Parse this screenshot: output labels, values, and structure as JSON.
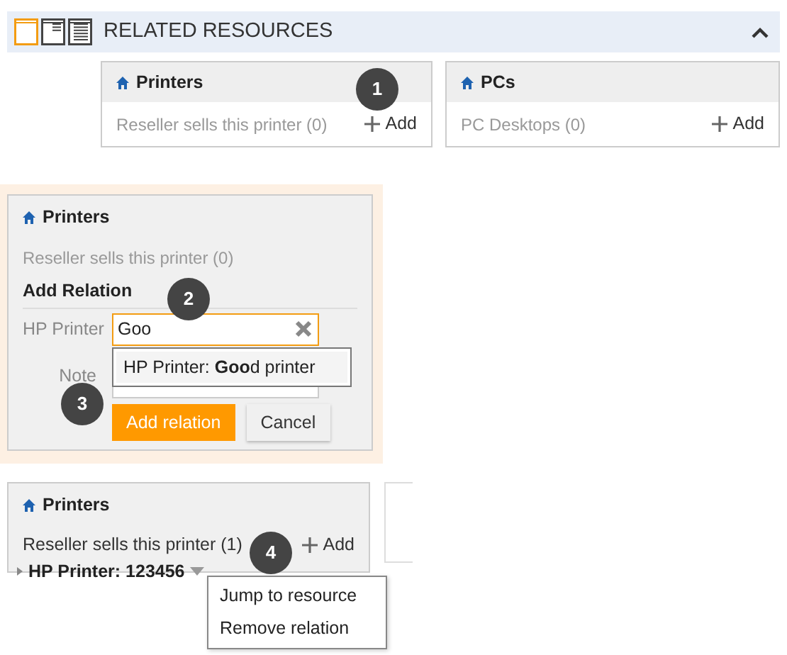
{
  "header": {
    "title": "RELATED RESOURCES",
    "views": [
      {
        "selected": true
      },
      {
        "selected": false
      },
      {
        "selected": false
      }
    ]
  },
  "cards": [
    {
      "title": "Printers",
      "relation": "Reseller sells this printer (0)",
      "add": "Add",
      "callout": "1"
    },
    {
      "title": "PCs",
      "relation": "PC Desktops (0)",
      "add": "Add"
    }
  ],
  "add_form": {
    "title": "Printers",
    "relation": "Reseller sells this printer (0)",
    "heading": "Add Relation",
    "field_label": "HP Printer",
    "value": "Goo",
    "suggestion": "HP Printer: **Goo**d printer",
    "note_label": "Note",
    "buttons": [
      {
        "label": "Add relation",
        "kind": "primary"
      },
      {
        "label": "Cancel",
        "kind": "secondary"
      }
    ],
    "field_callout": "2",
    "button_callout": "3"
  },
  "related": {
    "title": "Printers",
    "relation": "Reseller sells this printer (1)",
    "add": "Add",
    "item": "HP Printer: 123456",
    "menu": [
      "Jump to resource",
      "Remove relation"
    ],
    "callout": "4"
  }
}
